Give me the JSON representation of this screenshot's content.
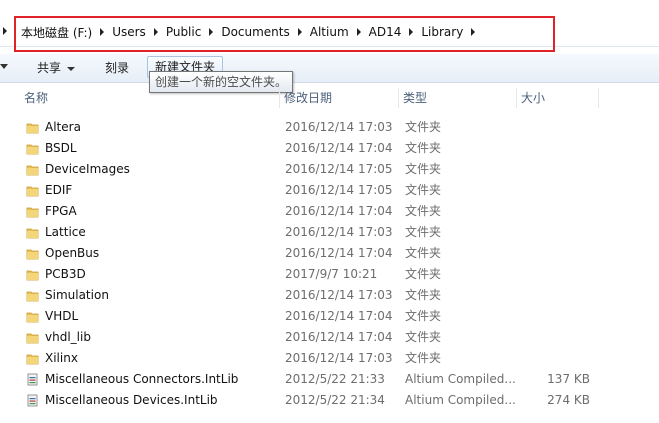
{
  "address": {
    "crumbs": [
      "本地磁盘 (F:)",
      "Users",
      "Public",
      "Documents",
      "Altium",
      "AD14",
      "Library"
    ]
  },
  "toolbar": {
    "share_label": "共享",
    "burn_label": "刻录",
    "new_folder_label": "新建文件夹",
    "tooltip": "创建一个新的空文件夹。"
  },
  "columns": {
    "name": "名称",
    "date": "修改日期",
    "type": "类型",
    "size": "大小"
  },
  "files": [
    {
      "name": "Altera",
      "date": "2016/12/14 17:03",
      "type": "文件夹",
      "size": "",
      "icon": "folder-icon"
    },
    {
      "name": "BSDL",
      "date": "2016/12/14 17:04",
      "type": "文件夹",
      "size": "",
      "icon": "folder-icon"
    },
    {
      "name": "DeviceImages",
      "date": "2016/12/14 17:05",
      "type": "文件夹",
      "size": "",
      "icon": "folder-icon"
    },
    {
      "name": "EDIF",
      "date": "2016/12/14 17:05",
      "type": "文件夹",
      "size": "",
      "icon": "folder-icon"
    },
    {
      "name": "FPGA",
      "date": "2016/12/14 17:04",
      "type": "文件夹",
      "size": "",
      "icon": "folder-icon"
    },
    {
      "name": "Lattice",
      "date": "2016/12/14 17:03",
      "type": "文件夹",
      "size": "",
      "icon": "folder-icon"
    },
    {
      "name": "OpenBus",
      "date": "2016/12/14 17:04",
      "type": "文件夹",
      "size": "",
      "icon": "folder-icon"
    },
    {
      "name": "PCB3D",
      "date": "2017/9/7 10:21",
      "type": "文件夹",
      "size": "",
      "icon": "folder-icon"
    },
    {
      "name": "Simulation",
      "date": "2016/12/14 17:03",
      "type": "文件夹",
      "size": "",
      "icon": "folder-icon"
    },
    {
      "name": "VHDL",
      "date": "2016/12/14 17:04",
      "type": "文件夹",
      "size": "",
      "icon": "folder-icon"
    },
    {
      "name": "vhdl_lib",
      "date": "2016/12/14 17:04",
      "type": "文件夹",
      "size": "",
      "icon": "folder-icon"
    },
    {
      "name": "Xilinx",
      "date": "2016/12/14 17:03",
      "type": "文件夹",
      "size": "",
      "icon": "folder-icon"
    },
    {
      "name": "Miscellaneous Connectors.IntLib",
      "date": "2012/5/22 21:33",
      "type": "Altium Compiled...",
      "size": "137 KB",
      "icon": "intlib-file-icon"
    },
    {
      "name": "Miscellaneous Devices.IntLib",
      "date": "2012/5/22 21:34",
      "type": "Altium Compiled...",
      "size": "274 KB",
      "icon": "intlib-file-icon"
    }
  ],
  "colors": {
    "highlight_box": "#e0222a",
    "folder": "#e8c25a",
    "header_text": "#4c607a"
  }
}
